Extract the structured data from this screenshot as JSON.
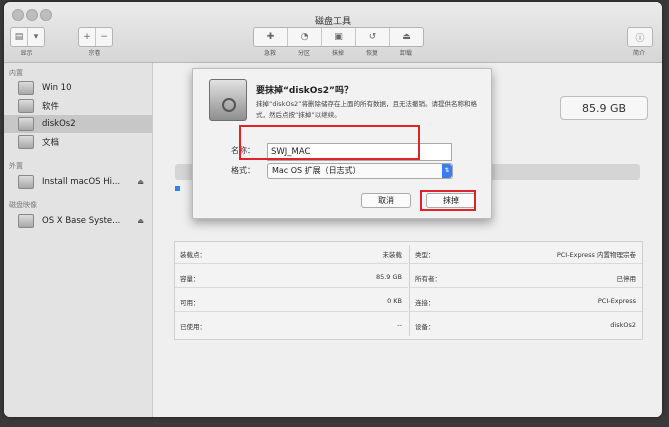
{
  "window": {
    "title": "磁盘工具"
  },
  "toolbar": {
    "view_label": "显示",
    "volume_label": "宗卷",
    "actions": [
      "急救",
      "分区",
      "抹掉",
      "恢复",
      "卸载"
    ],
    "info_label": "简介"
  },
  "sidebar": {
    "section_internal": "内置",
    "section_external": "外置",
    "section_image": "磁盘映像",
    "internal_items": [
      "Win 10",
      "软件",
      "diskOs2",
      "文档"
    ],
    "external_items": [
      "Install macOS Hi..."
    ],
    "image_items": [
      "OS X Base Syste..."
    ],
    "selected": "diskOs2"
  },
  "main": {
    "capacity": "85.9 GB"
  },
  "info": {
    "left": [
      {
        "k": "装载点：",
        "v": "未装载"
      },
      {
        "k": "容量：",
        "v": "85.9 GB"
      },
      {
        "k": "可用：",
        "v": "0 KB"
      },
      {
        "k": "已使用：",
        "v": "--"
      }
    ],
    "right": [
      {
        "k": "类型：",
        "v": "PCI-Express 内置物理宗卷"
      },
      {
        "k": "所有者：",
        "v": "已停用"
      },
      {
        "k": "连接：",
        "v": "PCI-Express"
      },
      {
        "k": "设备：",
        "v": "diskOs2"
      }
    ]
  },
  "dialog": {
    "title": "要抹掉“diskOs2”吗？",
    "message": "抹掉“diskOs2”将删除储存在上面的所有数据，且无法撤销。请提供名称和格式，然后点按“抹掉”以继续。",
    "name_label": "名称：",
    "name_value": "SWJ_MAC",
    "format_label": "格式：",
    "format_value": "Mac OS 扩展（日志式）",
    "cancel_label": "取消",
    "erase_label": "抹掉"
  },
  "colors": {
    "highlight": "#e0222a",
    "accent": "#3b7cf2"
  }
}
